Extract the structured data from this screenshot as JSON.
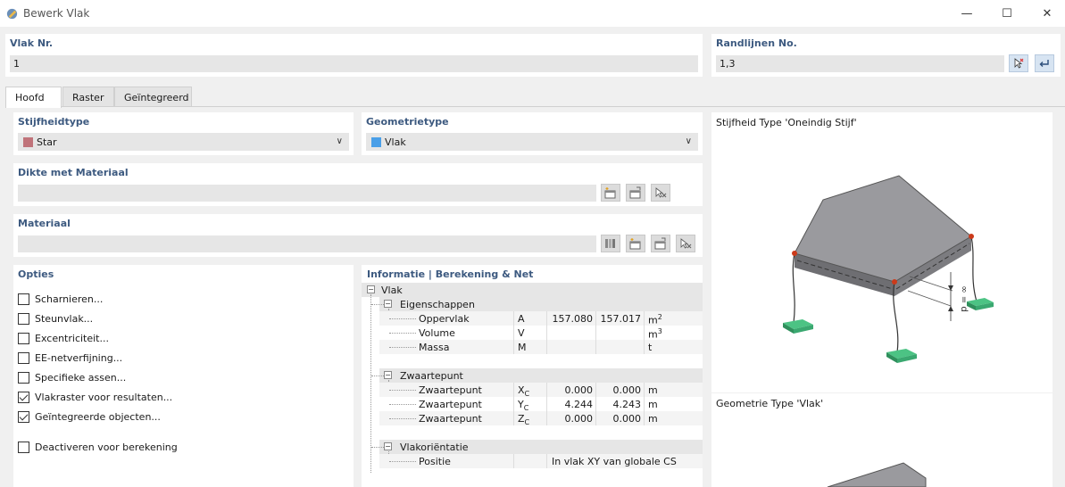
{
  "window": {
    "title": "Bewerk Vlak",
    "min": "—",
    "max": "☐",
    "close": "✕"
  },
  "top": {
    "vlak_nr_label": "Vlak Nr.",
    "vlak_nr_value": "1",
    "randlijnen_label": "Randlijnen No.",
    "randlijnen_value": "1,3"
  },
  "tabs": [
    {
      "label": "Hoofd",
      "active": true
    },
    {
      "label": "Raster",
      "active": false
    },
    {
      "label": "Geïntegreerd",
      "active": false
    }
  ],
  "stijfheid": {
    "label": "Stijfheidtype",
    "value": "Star",
    "color": "#c0737a"
  },
  "geometrie": {
    "label": "Geometrietype",
    "value": "Vlak",
    "color": "#4a9fe8"
  },
  "dikte": {
    "label": "Dikte met Materiaal",
    "value": ""
  },
  "materiaal": {
    "label": "Materiaal",
    "value": ""
  },
  "opties": {
    "label": "Opties",
    "items": [
      {
        "label": "Scharnieren...",
        "checked": false
      },
      {
        "label": "Steunvlak...",
        "checked": false
      },
      {
        "label": "Excentriciteit...",
        "checked": false
      },
      {
        "label": "EE-netverfijning...",
        "checked": false
      },
      {
        "label": "Specifieke assen...",
        "checked": false
      },
      {
        "label": "Vlakraster voor resultaten...",
        "checked": true
      },
      {
        "label": "Geïntegreerde objecten...",
        "checked": true
      },
      {
        "label": "Deactiveren voor berekening",
        "checked": false
      }
    ]
  },
  "info": {
    "label": "Informatie | Berekening & Net",
    "root": "Vlak",
    "eigenschappen": {
      "label": "Eigenschappen",
      "rows": [
        {
          "name": "Oppervlak",
          "sym": "A",
          "v1": "157.080",
          "v2": "157.017",
          "unit": "m",
          "sup": "2"
        },
        {
          "name": "Volume",
          "sym": "V",
          "v1": "",
          "v2": "",
          "unit": "m",
          "sup": "3"
        },
        {
          "name": "Massa",
          "sym": "M",
          "v1": "",
          "v2": "",
          "unit": "t",
          "sup": ""
        }
      ]
    },
    "zwaartepunt": {
      "label": "Zwaartepunt",
      "rows": [
        {
          "name": "Zwaartepunt",
          "sym": "X",
          "sub": "C",
          "v1": "0.000",
          "v2": "0.000",
          "unit": "m"
        },
        {
          "name": "Zwaartepunt",
          "sym": "Y",
          "sub": "C",
          "v1": "4.244",
          "v2": "4.243",
          "unit": "m"
        },
        {
          "name": "Zwaartepunt",
          "sym": "Z",
          "sub": "C",
          "v1": "0.000",
          "v2": "0.000",
          "unit": "m"
        }
      ]
    },
    "orientatie": {
      "label": "Vlakoriëntatie",
      "rows": [
        {
          "name": "Positie",
          "value": "In vlak XY van globale CS"
        }
      ]
    }
  },
  "previews": {
    "stijfheid_title": "Stijfheid Type 'Oneindig Stijf'",
    "geometrie_title": "Geometrie Type 'Vlak'",
    "dim_label": "∞ = d"
  },
  "colors": {
    "label_blue": "#3d5a80",
    "slab_top": "#9a9a9e",
    "support_green": "#3aa870",
    "node_red": "#cc3a1a"
  }
}
